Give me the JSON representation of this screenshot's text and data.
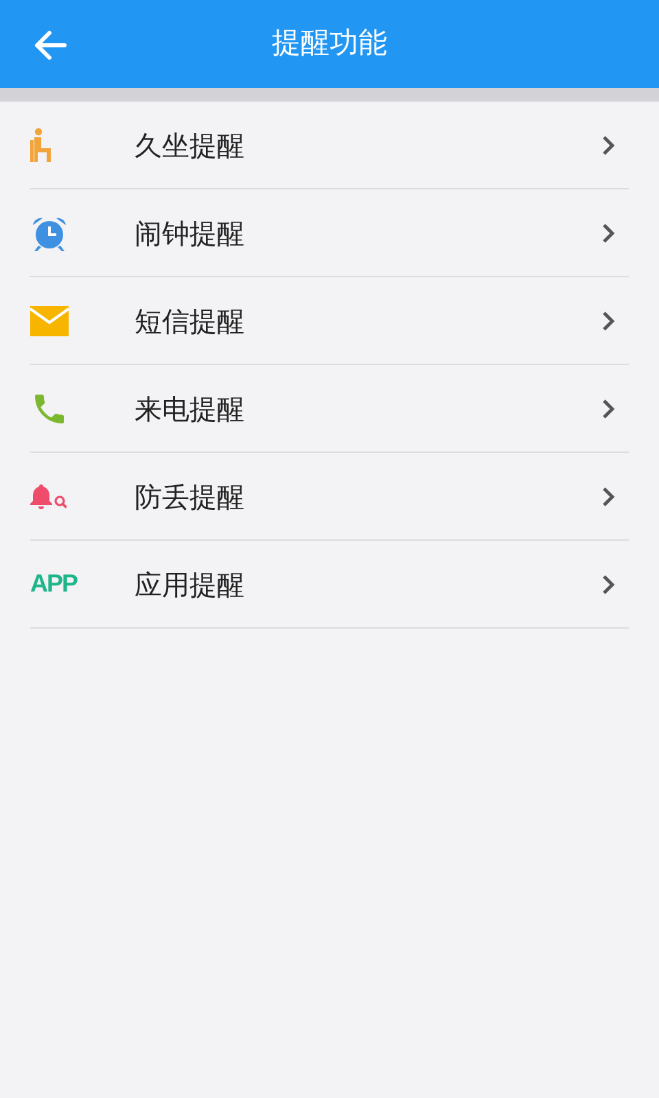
{
  "header": {
    "title": "提醒功能"
  },
  "items": [
    {
      "kind": "sitting",
      "label": "久坐提醒"
    },
    {
      "kind": "alarm",
      "label": "闹钟提醒"
    },
    {
      "kind": "message",
      "label": "短信提醒"
    },
    {
      "kind": "call",
      "label": "来电提醒"
    },
    {
      "kind": "antilost",
      "label": "防丢提醒"
    },
    {
      "kind": "app",
      "icon_text": "APP",
      "label": "应用提醒"
    }
  ]
}
